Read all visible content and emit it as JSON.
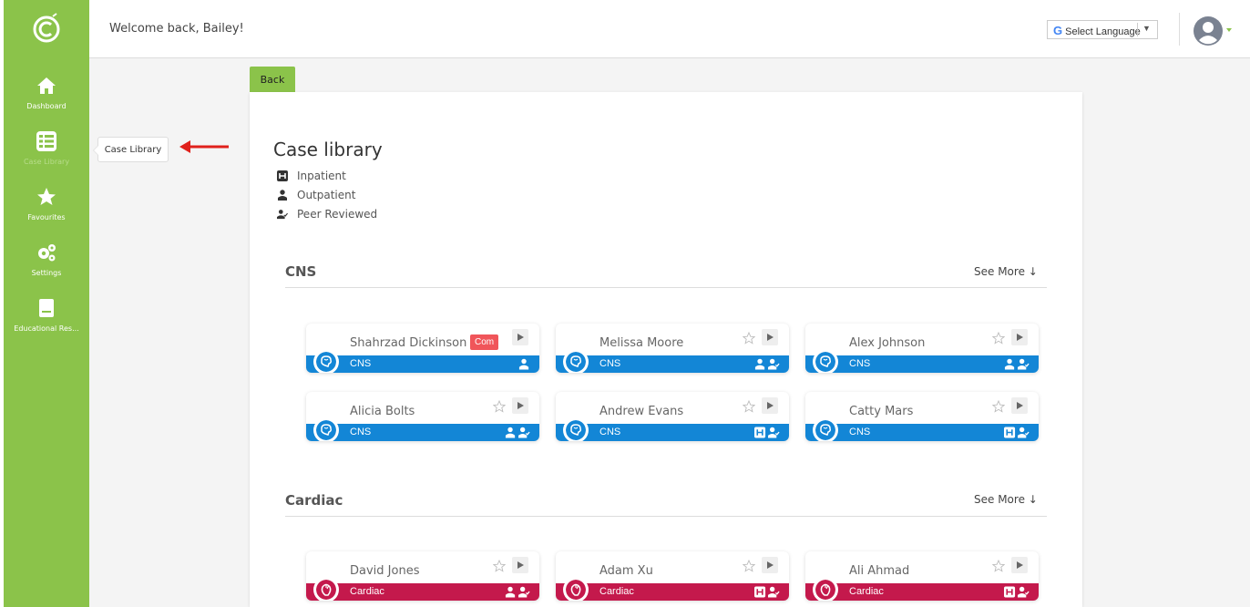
{
  "sidebar": {
    "items": [
      {
        "label": "Dashboard",
        "icon": "home-icon"
      },
      {
        "label": "Case Library",
        "icon": "table-icon",
        "active": true
      },
      {
        "label": "Favourites",
        "icon": "star-icon"
      },
      {
        "label": "Settings",
        "icon": "cogs-icon"
      },
      {
        "label": "Educational Res...",
        "icon": "book-icon"
      }
    ]
  },
  "topbar": {
    "welcome": "Welcome back, Bailey!",
    "language": "Select Language",
    "language_caret": "▼"
  },
  "tooltip": "Case Library",
  "back_label": "Back",
  "page": {
    "title": "Case library",
    "legend": [
      {
        "label": "Inpatient",
        "icon": "inpatient-icon"
      },
      {
        "label": "Outpatient",
        "icon": "outpatient-icon"
      },
      {
        "label": "Peer Reviewed",
        "icon": "peer-reviewed-icon"
      }
    ]
  },
  "sections": [
    {
      "title": "CNS",
      "see_more": "See More ↓",
      "cards": [
        {
          "name": "Shahrzad Dickinson",
          "category": "CNS",
          "tag": "Com",
          "icons": [
            "outpatient-icon"
          ]
        },
        {
          "name": "Melissa Moore",
          "category": "CNS",
          "icons": [
            "outpatient-icon",
            "peer-reviewed-icon"
          ]
        },
        {
          "name": "Alex Johnson",
          "category": "CNS",
          "icons": [
            "outpatient-icon",
            "peer-reviewed-icon"
          ]
        },
        {
          "name": "Alicia Bolts",
          "category": "CNS",
          "icons": [
            "outpatient-icon",
            "peer-reviewed-icon"
          ]
        },
        {
          "name": "Andrew Evans",
          "category": "CNS",
          "icons": [
            "inpatient-icon",
            "peer-reviewed-icon"
          ]
        },
        {
          "name": "Catty Mars",
          "category": "CNS",
          "icons": [
            "inpatient-icon",
            "peer-reviewed-icon"
          ]
        }
      ]
    },
    {
      "title": "Cardiac",
      "see_more": "See More ↓",
      "cards": [
        {
          "name": "David Jones",
          "category": "Cardiac",
          "icons": [
            "outpatient-icon",
            "peer-reviewed-icon"
          ]
        },
        {
          "name": "Adam Xu",
          "category": "Cardiac",
          "icons": [
            "inpatient-icon",
            "peer-reviewed-icon"
          ]
        },
        {
          "name": "Ali Ahmad",
          "category": "Cardiac",
          "icons": [
            "inpatient-icon",
            "peer-reviewed-icon"
          ]
        }
      ]
    }
  ],
  "colors": {
    "sidebar": "#8bc34a",
    "cns": "#1386d6",
    "cardiac": "#c4194c",
    "com_tag": "#f0555a",
    "annotation_arrow": "#e0201b"
  }
}
